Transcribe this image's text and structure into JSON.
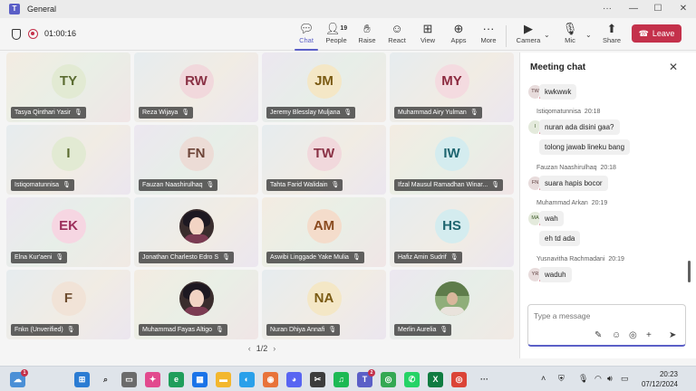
{
  "window": {
    "title": "General",
    "app_icon": "teams-icon"
  },
  "toolbar": {
    "timer": "01:00:16",
    "buttons": {
      "chat": "Chat",
      "people": "People",
      "people_count": "19",
      "raise": "Raise",
      "react": "React",
      "view": "View",
      "apps": "Apps",
      "more": "More",
      "camera": "Camera",
      "mic": "Mic",
      "share": "Share"
    },
    "leave": "Leave"
  },
  "participants": [
    {
      "initials": "TY",
      "name": "Tasya Qinthari Yasir",
      "avatar_bg": "#e2ead3",
      "avatar_fg": "#5a6b30"
    },
    {
      "initials": "RW",
      "name": "Reza Wijaya",
      "avatar_bg": "#f1d8dc",
      "avatar_fg": "#8a3145"
    },
    {
      "initials": "JM",
      "name": "Jeremy Blesslay Muljana",
      "avatar_bg": "#f4e7c6",
      "avatar_fg": "#7a5a12"
    },
    {
      "initials": "MY",
      "name": "Muhammad Airy Yulman",
      "avatar_bg": "#f4dbe0",
      "avatar_fg": "#8c2a3f"
    },
    {
      "initials": "I",
      "name": "Istiqomatunnisa",
      "avatar_bg": "#e2ead3",
      "avatar_fg": "#5a6b30"
    },
    {
      "initials": "FN",
      "name": "Fauzan Naashirulhaq",
      "avatar_bg": "#ecdcd6",
      "avatar_fg": "#6e4538"
    },
    {
      "initials": "TW",
      "name": "Tahta Farid Walidain",
      "avatar_bg": "#f1d8dc",
      "avatar_fg": "#8a3145"
    },
    {
      "initials": "IW",
      "name": "Ifzal Mausul Ramadhan Winar...",
      "avatar_bg": "#d4ecef",
      "avatar_fg": "#1f6670"
    },
    {
      "initials": "EK",
      "name": "Elna Kur'aeni",
      "avatar_bg": "#f6d6e2",
      "avatar_fg": "#9b2d5a"
    },
    {
      "initials": "",
      "name": "Jonathan Charlesto Edro S",
      "photo": true
    },
    {
      "initials": "AM",
      "name": "Aswibi Linggade Yake Mulia",
      "avatar_bg": "#f4dccb",
      "avatar_fg": "#8a4a1f"
    },
    {
      "initials": "HS",
      "name": "Hafiz Amin Sudrif",
      "avatar_bg": "#d4ecef",
      "avatar_fg": "#1f6670"
    },
    {
      "initials": "F",
      "name": "Fnkn (Unverified)",
      "avatar_bg": "#f1e3d7",
      "avatar_fg": "#6e4d2f"
    },
    {
      "initials": "",
      "name": "Muhammad Fayas Altigo",
      "photo": true
    },
    {
      "initials": "NA",
      "name": "Nuran Dhiya Annafi",
      "avatar_bg": "#f4e7c6",
      "avatar_fg": "#7a5a12"
    },
    {
      "initials": "",
      "name": "Merlin Aurelia",
      "photo": true
    }
  ],
  "pager": {
    "label": "1/2",
    "prev": "‹",
    "next": "›"
  },
  "chat": {
    "title": "Meeting chat",
    "messages": [
      {
        "avatar": "TW",
        "text": "kwkwwk"
      },
      {
        "sender": "Istiqomatunnisa",
        "time": "20:18",
        "avatar": "I",
        "text": "nuran ada disini gaa?"
      },
      {
        "text": "tolong jawab lineku bang"
      },
      {
        "sender": "Fauzan Naashirulhaq",
        "time": "20:18",
        "avatar": "FN",
        "text": "suara hapis bocor"
      },
      {
        "sender": "Muhammad Arkan",
        "time": "20:19",
        "avatar": "MA",
        "text": "wah"
      },
      {
        "text": "eh td ada"
      },
      {
        "sender": "Yusnavitha Rachmadani",
        "time": "20:19",
        "avatar": "YR",
        "text": "waduh"
      }
    ],
    "compose_placeholder": "Type a message"
  },
  "taskbar": {
    "badge_count": "1",
    "teams_badge": "2",
    "time": "20:23",
    "date": "07/12/2024"
  }
}
